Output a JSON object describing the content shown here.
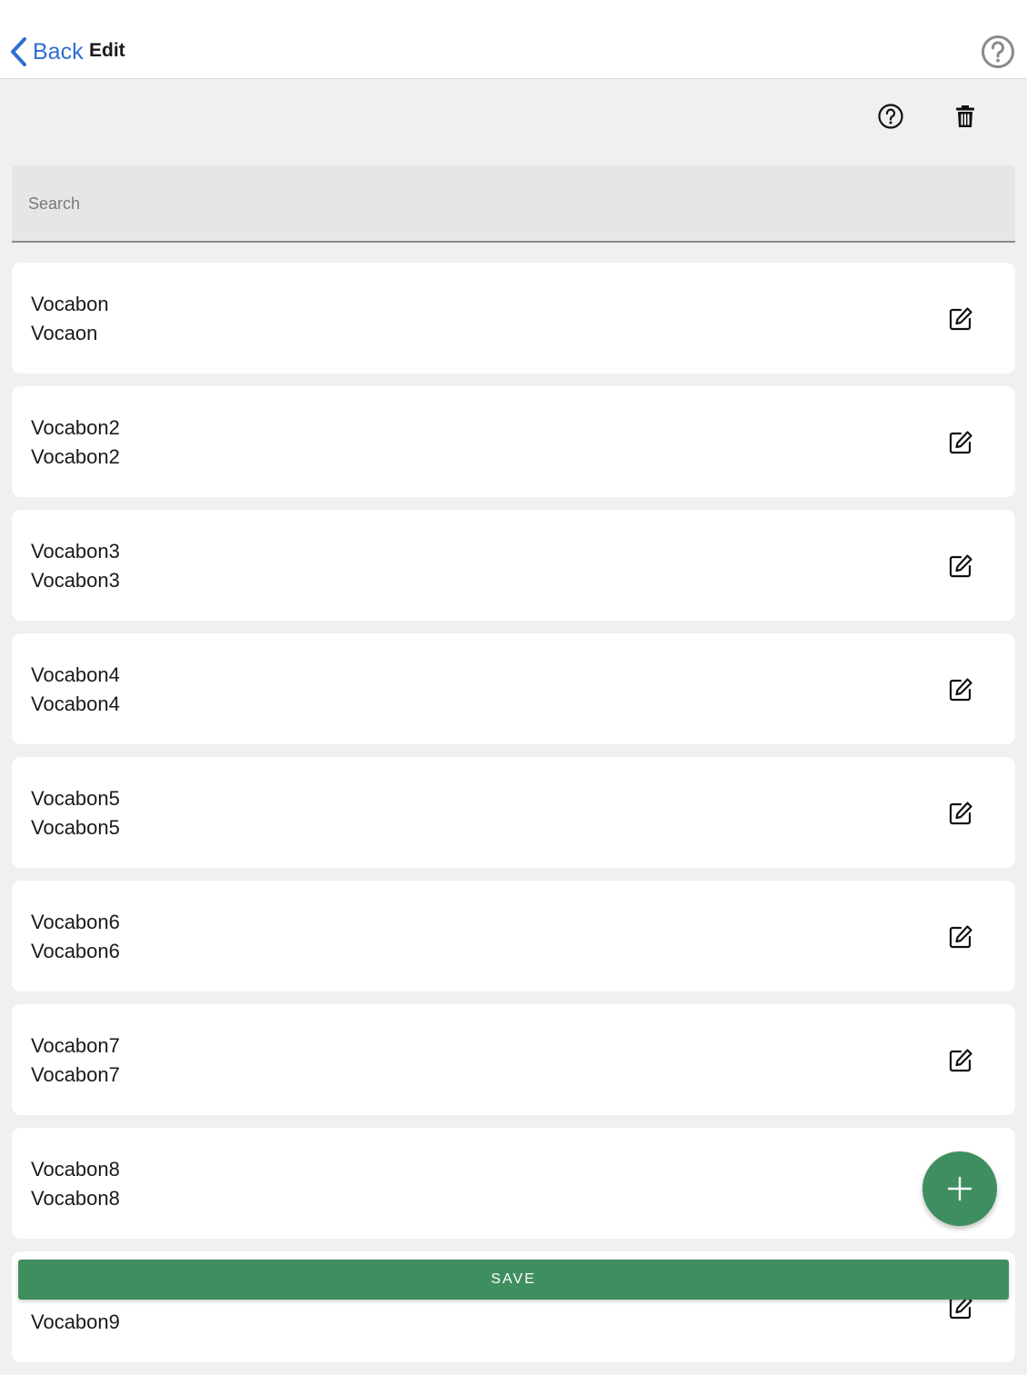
{
  "header": {
    "back_label": "Back",
    "title": "Edit",
    "help_icon": "help-circle-icon"
  },
  "toolbar": {
    "help_icon": "help-circle-icon",
    "delete_icon": "trash-icon"
  },
  "search": {
    "placeholder": "Search",
    "value": ""
  },
  "list": {
    "items": [
      {
        "word": "Vocabon",
        "translation": "Vocaon"
      },
      {
        "word": "Vocabon2",
        "translation": "Vocabon2"
      },
      {
        "word": "Vocabon3",
        "translation": "Vocabon3"
      },
      {
        "word": "Vocabon4",
        "translation": "Vocabon4"
      },
      {
        "word": "Vocabon5",
        "translation": "Vocabon5"
      },
      {
        "word": "Vocabon6",
        "translation": "Vocabon6"
      },
      {
        "word": "Vocabon7",
        "translation": "Vocabon7"
      },
      {
        "word": "Vocabon8",
        "translation": "Vocabon8"
      },
      {
        "word": "Vocabon9",
        "translation": "Vocabon9"
      }
    ],
    "edit_icon": "edit-icon"
  },
  "fab": {
    "icon": "plus-icon"
  },
  "footer": {
    "save_label": "SAVE"
  },
  "colors": {
    "accent_green": "#3f8e5f",
    "link_blue": "#2f6fd0",
    "background": "#f0f0f0"
  }
}
